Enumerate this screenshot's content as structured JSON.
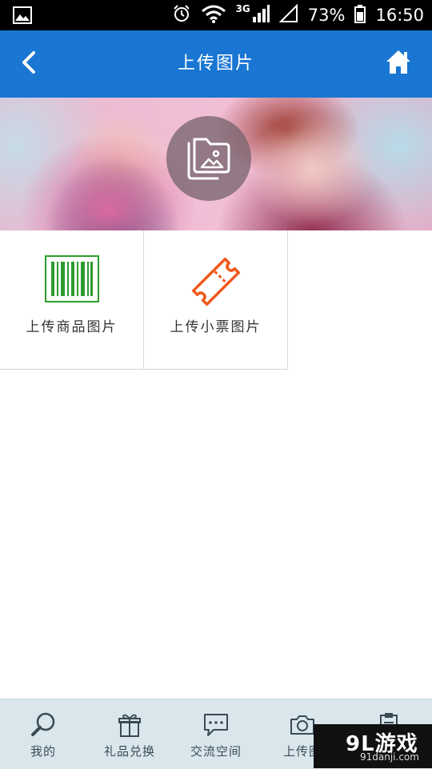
{
  "status_bar": {
    "network": "3G",
    "battery": "73%",
    "time": "16:50"
  },
  "header": {
    "title": "上传图片",
    "back_icon": "chevron-left-icon",
    "home_icon": "home-icon"
  },
  "banner": {
    "icon": "folder-image-icon"
  },
  "tiles": [
    {
      "label": "上传商品图片",
      "icon": "barcode-icon",
      "color": "#2e9b2e"
    },
    {
      "label": "上传小票图片",
      "icon": "ticket-icon",
      "color": "#ef5a1c"
    }
  ],
  "bottom_nav": [
    {
      "label": "我的",
      "icon": "search-icon"
    },
    {
      "label": "礼品兑换",
      "icon": "gift-icon"
    },
    {
      "label": "交流空间",
      "icon": "chat-bubble-icon"
    },
    {
      "label": "上传图",
      "icon": "camera-icon"
    },
    {
      "label": "",
      "icon": "clipboard-icon"
    }
  ],
  "watermark": {
    "main": "9L游戏",
    "sub": "91danji.com"
  },
  "colors": {
    "header_bg": "#1976d2",
    "nav_bg": "#d9e7ec",
    "barcode": "#2e9b2e",
    "ticket": "#ef5a1c"
  }
}
